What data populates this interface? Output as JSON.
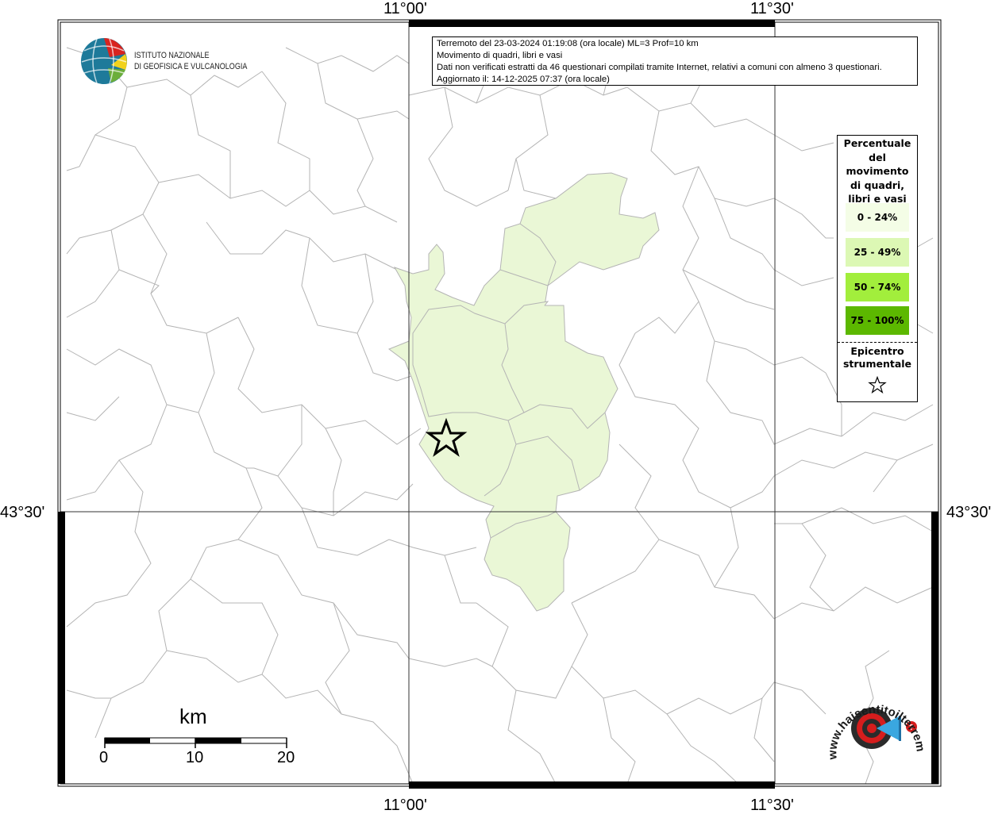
{
  "axes": {
    "top_labels": [
      "11°00'",
      "11°30'"
    ],
    "bottom_labels": [
      "11°00'",
      "11°30'"
    ],
    "left_labels": [
      "43°30'"
    ],
    "right_labels": [
      "43°30'"
    ]
  },
  "info": {
    "line1": "Terremoto del 23-03-2024 01:19:08 (ora locale) ML=3 Prof=10 km",
    "line2": "Movimento di quadri, libri e vasi",
    "line3": "Dati non verificati estratti da 46 questionari compilati tramite Internet, relativi a comuni con almeno 3 questionari.",
    "line4": "Aggiornato il: 14-12-2025 07:37 (ora locale)"
  },
  "institution": {
    "line1": "ISTITUTO NAZIONALE",
    "line2": "DI GEOFISICA E VULCANOLOGIA"
  },
  "legend": {
    "title": "Percentuale del movimento di quadri, libri e vasi",
    "items": [
      {
        "label": "0 - 24%",
        "color": "#f4fde6"
      },
      {
        "label": "25 - 49%",
        "color": "#dcf8b4"
      },
      {
        "label": "50 - 74%",
        "color": "#a2ee3c"
      },
      {
        "label": "75 - 100%",
        "color": "#5cb800"
      }
    ],
    "epicenter_label": "Epicentro strumentale"
  },
  "scale_bar": {
    "unit": "km",
    "ticks": [
      "0",
      "10",
      "20"
    ]
  },
  "watermark": {
    "text": "www.haisentitoilterremoto.it"
  },
  "colors": {
    "felt_area": "#eaf7d6",
    "boundaries": "#b4b4b4",
    "grid": "#333333"
  },
  "icons": {
    "epicenter": "star-icon",
    "ingv_logo": "globe-icon"
  }
}
